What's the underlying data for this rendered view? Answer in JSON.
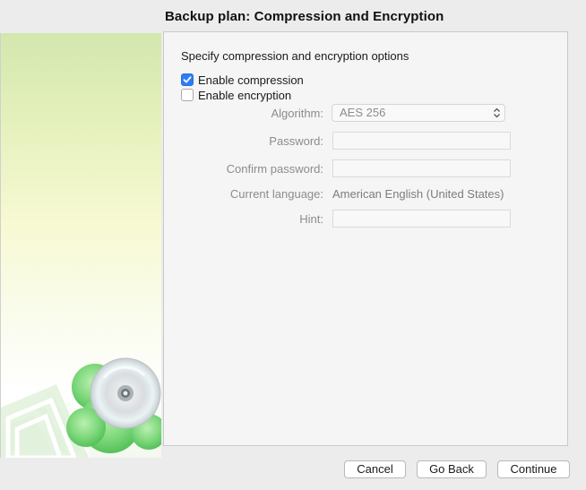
{
  "window": {
    "title": "Backup plan: Compression and Encryption"
  },
  "sidebar": {
    "illustration_icon": "cd-disc-cloud-icon"
  },
  "content": {
    "heading": "Specify compression and encryption options",
    "enable_compression": {
      "label": "Enable compression",
      "checked": true
    },
    "enable_encryption": {
      "label": "Enable encryption",
      "checked": false
    },
    "algorithm": {
      "label": "Algorithm:",
      "value": "AES 256"
    },
    "password": {
      "label": "Password:",
      "value": ""
    },
    "confirm_password": {
      "label": "Confirm password:",
      "value": ""
    },
    "current_language": {
      "label": "Current language:",
      "value": "American English (United States)"
    },
    "hint": {
      "label": "Hint:",
      "value": ""
    }
  },
  "buttons": {
    "cancel": "Cancel",
    "go_back": "Go Back",
    "continue": "Continue"
  },
  "colors": {
    "accent": "#2f7df6",
    "disabled_text": "#8c8c8c",
    "sidebar_green": "#7cd47a"
  }
}
